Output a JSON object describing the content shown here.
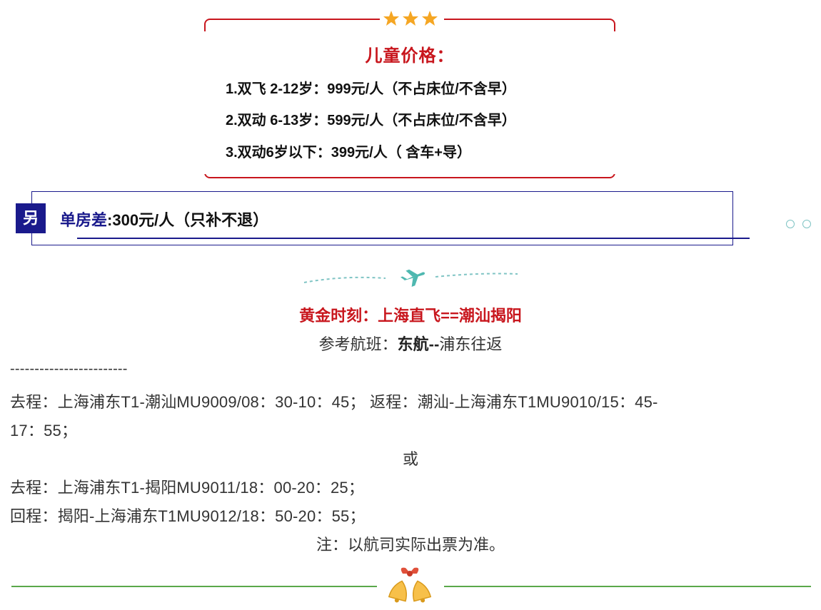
{
  "child_price": {
    "title": "儿童价格：",
    "lines": [
      "1.双飞 2-12岁：999元/人（不占床位/不含早）",
      "2.双动 6-13岁：599元/人（不占床位/不含早）",
      "3.双动6岁以下：399元/人（ 含车+导）"
    ],
    "star_color": "#f5a623",
    "border_color": "#c8161d"
  },
  "single_room": {
    "badge": "另",
    "label": "单房差",
    "value": ":300元/人（只补不退）",
    "color": "#1a1a8c"
  },
  "flight": {
    "heading": "黄金时刻：上海直飞==潮汕揭阳",
    "reference_prefix": "参考航班：",
    "reference_airline": "东航--",
    "reference_suffix": "浦东往返",
    "separator": "------------------------",
    "option1_line1": "去程：上海浦东T1-潮汕MU9009/08：30-10：45；      返程：潮汕-上海浦东T1MU9010/15：45-",
    "option1_line2": "17：55；",
    "or": "或",
    "option2_out": "去程：上海浦东T1-揭阳MU9011/18：00-20：25；",
    "option2_back": "回程：揭阳-上海浦东T1MU9012/18：50-20：55；",
    "note": "注：以航司实际出票为准。"
  },
  "icons": {
    "stars": "star-icon",
    "plane": "plane-icon",
    "bells": "bells-icon"
  }
}
